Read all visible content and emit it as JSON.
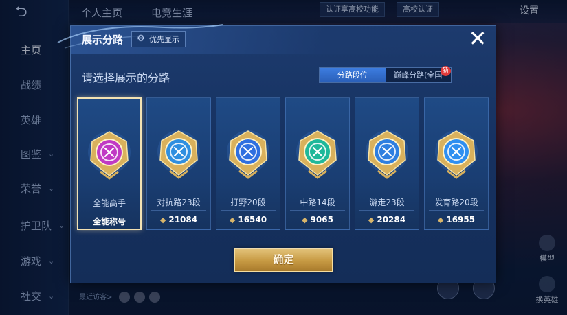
{
  "background": {
    "nav_items": [
      {
        "label": "主页",
        "chevron": false,
        "active": true
      },
      {
        "label": "战绩",
        "chevron": false,
        "active": false
      },
      {
        "label": "英雄",
        "chevron": false,
        "active": false
      },
      {
        "label": "图鉴",
        "chevron": true,
        "active": false
      },
      {
        "label": "荣誉",
        "chevron": true,
        "active": false
      },
      {
        "label": "护卫队",
        "chevron": true,
        "active": false
      },
      {
        "label": "游戏",
        "chevron": true,
        "active": false
      },
      {
        "label": "社交",
        "chevron": true,
        "active": false
      }
    ],
    "top_tabs": [
      "个人主页",
      "电竞生涯"
    ],
    "top_pills": [
      "认证享高校功能",
      "高校认证"
    ],
    "settings_label": "设置",
    "recent_visitors_label": "最近访客>",
    "right_tools": [
      "模型",
      "换英雄"
    ]
  },
  "dialog": {
    "title": "展示分路",
    "priority_button": "优先显示",
    "subtitle": "请选择展示的分路",
    "toggle_options": [
      "分路段位",
      "巅峰分路(全国"
    ],
    "toggle_selected_index": 0,
    "new_badge": "新",
    "close_icon": "close-icon",
    "cards": [
      {
        "label": "全能高手",
        "value": "全能称号",
        "selected": true,
        "emblem": "all-round-emblem-icon",
        "emblem_color": "#c03ac4",
        "show_value_icon": false
      },
      {
        "label": "对抗路23段",
        "value": "21084",
        "selected": false,
        "emblem": "clash-lane-emblem-icon",
        "emblem_color": "#2f8fe0",
        "show_value_icon": true
      },
      {
        "label": "打野20段",
        "value": "16540",
        "selected": false,
        "emblem": "jungle-emblem-icon",
        "emblem_color": "#2f6fe0",
        "show_value_icon": true
      },
      {
        "label": "中路14段",
        "value": "9065",
        "selected": false,
        "emblem": "mid-lane-emblem-icon",
        "emblem_color": "#1fb89a",
        "show_value_icon": true
      },
      {
        "label": "游走23段",
        "value": "20284",
        "selected": false,
        "emblem": "roam-emblem-icon",
        "emblem_color": "#2f7fe0",
        "show_value_icon": true
      },
      {
        "label": "发育路20段",
        "value": "16955",
        "selected": false,
        "emblem": "farm-lane-emblem-icon",
        "emblem_color": "#2f8ff0",
        "show_value_icon": true
      }
    ],
    "confirm_label": "确定"
  },
  "colors": {
    "dialog_bg": "#163261",
    "accent_blue": "#2a5fb8",
    "gold": "#c79a43",
    "selected_border": "#f3e2b3"
  }
}
